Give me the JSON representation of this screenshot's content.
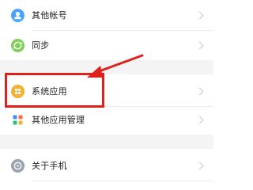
{
  "items": [
    {
      "label": "其他帐号",
      "icon": "account-icon"
    },
    {
      "label": "同步",
      "icon": "sync-icon"
    },
    {
      "label": "系统应用",
      "icon": "system-apps-icon"
    },
    {
      "label": "其他应用管理",
      "icon": "app-management-icon"
    },
    {
      "label": "关于手机",
      "icon": "about-phone-icon"
    }
  ],
  "colors": {
    "accent_red": "#e0201a",
    "account_blue": "#4aa3ff",
    "sync_green": "#7fcf5a",
    "system_orange": "#f4b030",
    "about_gray": "#9aa3ad"
  }
}
